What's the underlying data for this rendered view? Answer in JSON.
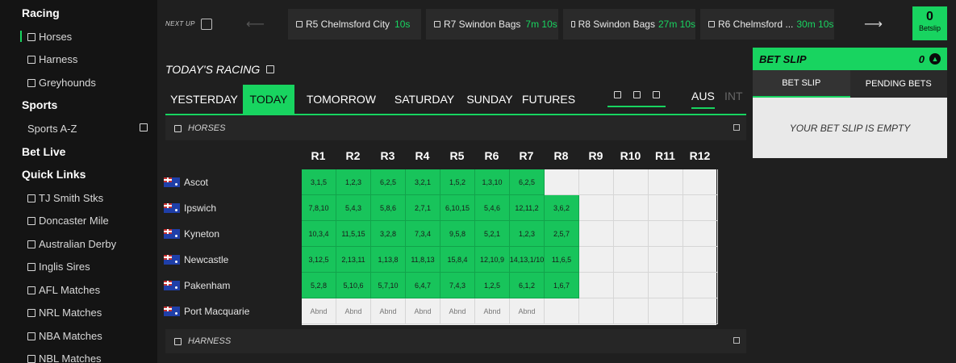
{
  "sidebar": {
    "racing_head": "Racing",
    "racing_items": [
      "Horses",
      "Harness",
      "Greyhounds"
    ],
    "sports_head": "Sports",
    "sports_az": "Sports A-Z",
    "betlive_head": "Bet Live",
    "quick_head": "Quick Links",
    "quick_items": [
      "TJ Smith Stks",
      "Doncaster Mile",
      "Australian Derby",
      "Inglis Sires",
      "AFL Matches",
      "NRL Matches",
      "NBA Matches",
      "NBL Matches"
    ]
  },
  "nextup": {
    "label": "NEXT UP",
    "races": [
      {
        "name": "R5 Chelmsford City",
        "time": "10s"
      },
      {
        "name": "R7 Swindon Bags",
        "time": "7m 10s"
      },
      {
        "name": "R8 Swindon Bags",
        "time": "27m 10s"
      },
      {
        "name": "R6 Chelmsford ...",
        "time": "30m 10s"
      }
    ],
    "betslip_count": "0",
    "betslip_label": "Betslip"
  },
  "racing": {
    "title": "TODAY'S RACING",
    "tabs": [
      "YESTERDAY",
      "TODAY",
      "TOMORROW",
      "SATURDAY",
      "SUNDAY",
      "FUTURES"
    ],
    "active_tab": "TODAY",
    "regions": [
      "AUS",
      "INT"
    ],
    "section_horses": "HORSES",
    "section_harness": "HARNESS",
    "race_headers": [
      "R1",
      "R2",
      "R3",
      "R4",
      "R5",
      "R6",
      "R7",
      "R8",
      "R9",
      "R10",
      "R11",
      "R12"
    ],
    "venues": [
      {
        "name": "Ascot",
        "results": [
          "3,1,5",
          "1,2,3",
          "6,2,5",
          "3,2,1",
          "1,5,2",
          "1,3,10",
          "6,2,5"
        ]
      },
      {
        "name": "Ipswich",
        "results": [
          "7,8,10",
          "5,4,3",
          "5,8,6",
          "2,7,1",
          "6,10,15",
          "5,4,6",
          "12,11,2",
          "3,6,2"
        ]
      },
      {
        "name": "Kyneton",
        "results": [
          "10,3,4",
          "11,5,15",
          "3,2,8",
          "7,3,4",
          "9,5,8",
          "5,2,1",
          "1,2,3",
          "2,5,7"
        ]
      },
      {
        "name": "Newcastle",
        "results": [
          "3,12,5",
          "2,13,11",
          "1,13,8",
          "11,8,13",
          "15,8,4",
          "12,10,9",
          "14,13,1/10",
          "11,6,5"
        ]
      },
      {
        "name": "Pakenham",
        "results": [
          "5,2,8",
          "5,10,6",
          "5,7,10",
          "6,4,7",
          "7,4,3",
          "1,2,5",
          "6,1,2",
          "1,6,7"
        ]
      },
      {
        "name": "Port Macquarie",
        "results": [
          "Abnd",
          "Abnd",
          "Abnd",
          "Abnd",
          "Abnd",
          "Abnd",
          "Abnd"
        ]
      }
    ]
  },
  "betslip": {
    "title": "BET SLIP",
    "count": "0",
    "tabs": [
      "BET SLIP",
      "PENDING BETS"
    ],
    "empty_msg": "YOUR BET SLIP IS EMPTY"
  },
  "colors": {
    "accent": "#18d460",
    "cell_green": "#18c45b",
    "bg": "#1f1f1f"
  }
}
